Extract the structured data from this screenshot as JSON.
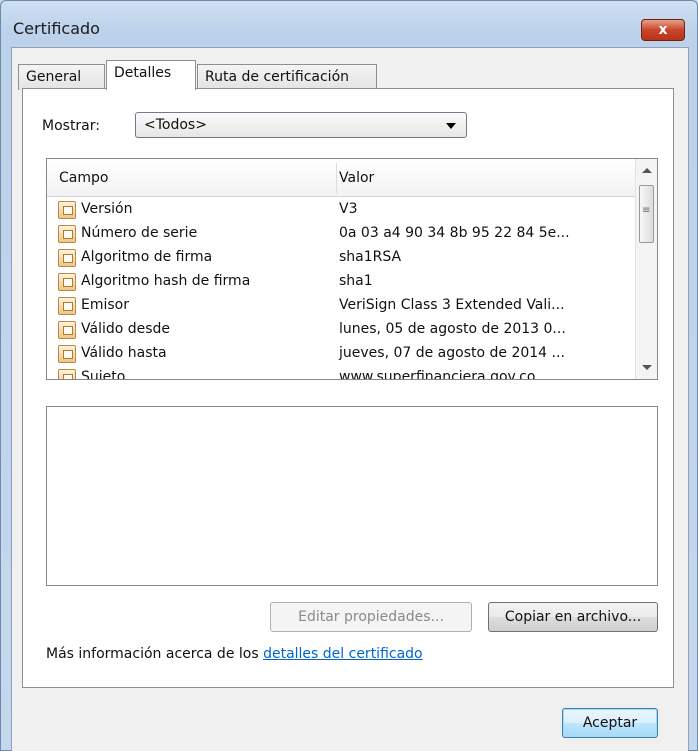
{
  "window": {
    "title": "Certificado",
    "close_label": "x"
  },
  "tabs": [
    {
      "label": "General",
      "active": false
    },
    {
      "label": "Detalles",
      "active": true
    },
    {
      "label": "Ruta de certificación",
      "active": false
    }
  ],
  "show": {
    "label": "Mostrar:",
    "selected": "<Todos>"
  },
  "fields_table": {
    "columns": [
      "Campo",
      "Valor"
    ],
    "rows": [
      {
        "campo": "Versión",
        "valor": "V3"
      },
      {
        "campo": "Número de serie",
        "valor": "0a 03 a4 90 34 8b 95 22 84 5e..."
      },
      {
        "campo": "Algoritmo de firma",
        "valor": "sha1RSA"
      },
      {
        "campo": "Algoritmo hash de firma",
        "valor": "sha1"
      },
      {
        "campo": "Emisor",
        "valor": "VeriSign Class 3 Extended Vali..."
      },
      {
        "campo": "Válido desde",
        "valor": "lunes, 05 de agosto de 2013 0..."
      },
      {
        "campo": "Válido hasta",
        "valor": "jueves, 07 de agosto de 2014 ..."
      },
      {
        "campo": "Sujeto",
        "valor": "www.superfinanciera.gov.co..."
      }
    ]
  },
  "buttons": {
    "edit_properties": "Editar propiedades...",
    "copy_to_file": "Copiar en archivo...",
    "ok": "Aceptar"
  },
  "info": {
    "text": "Más información acerca de los ",
    "link": "detalles del certificado"
  }
}
